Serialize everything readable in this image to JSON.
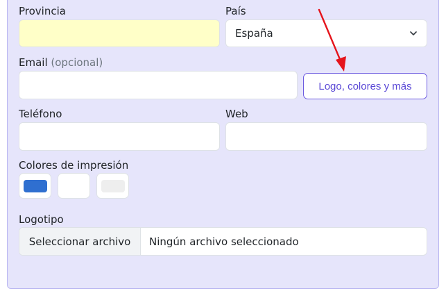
{
  "form": {
    "provincia": {
      "label": "Provincia",
      "value": ""
    },
    "pais": {
      "label": "País",
      "selected": "España"
    },
    "email": {
      "label": "Email",
      "hint": "(opcional)",
      "value": ""
    },
    "logo_button_label": "Logo, colores y más",
    "telefono": {
      "label": "Teléfono",
      "value": ""
    },
    "web": {
      "label": "Web",
      "value": ""
    },
    "colores": {
      "label": "Colores de impresión",
      "swatches": [
        "#2f6fd0",
        "#ffffff",
        "#eeeeee"
      ]
    },
    "logotipo": {
      "label": "Logotipo",
      "button_label": "Seleccionar archivo",
      "status": "Ningún archivo seleccionado"
    }
  },
  "annotation": {
    "arrow_color": "#e5141c"
  }
}
